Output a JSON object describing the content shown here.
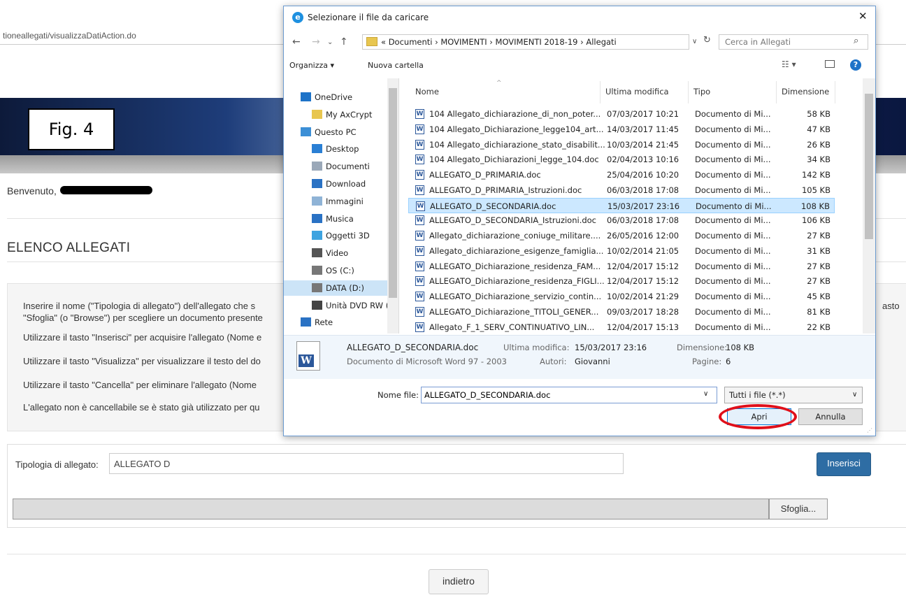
{
  "browser": {
    "url": "tioneallegati/visualizzaDatiAction.do"
  },
  "page": {
    "figure_label": "Fig. 4",
    "welcome": "Benvenuto,",
    "title": "ELENCO ALLEGATI",
    "instructions": [
      "Inserire il nome (\"Tipologia di allegato\") dell'allegato che s",
      "\"Sfoglia\" (o \"Browse\") per scegliere un documento presente",
      "Utilizzare il tasto \"Inserisci\" per acquisire l'allegato (Nome e",
      "Utilizzare il tasto \"Visualizza\" per visualizzare il testo del do",
      "Utilizzare il tasto \"Cancella\" per eliminare l'allegato (Nome",
      "L'allegato non è cancellabile se è stato già utilizzato per qu"
    ],
    "instructions_right": "asto",
    "type_label": "Tipologia di allegato:",
    "type_value": "ALLEGATO D",
    "insert_button": "Inserisci",
    "browse_button": "Sfoglia...",
    "back_button": "indietro"
  },
  "dialog": {
    "title": "Selezionare il file da caricare",
    "close": "✕",
    "breadcrumb": "«  Documenti  ›  MOVIMENTI  ›  MOVIMENTI 2018-19  ›  Allegati",
    "search_placeholder": "Cerca in Allegati",
    "toolbar": {
      "organize": "Organizza ▾",
      "new_folder": "Nuova cartella"
    },
    "nav_items": [
      {
        "label": "OneDrive",
        "icon": "cloud-icon",
        "color": "#1e73c8"
      },
      {
        "label": "My AxCrypt",
        "icon": "folder-icon",
        "color": "#e8c64f"
      },
      {
        "label": "Questo PC",
        "icon": "computer-icon",
        "color": "#3c8fd6"
      },
      {
        "label": "Desktop",
        "icon": "desktop-icon",
        "color": "#2a7fd4"
      },
      {
        "label": "Documenti",
        "icon": "documents-icon",
        "color": "#9aa8b8"
      },
      {
        "label": "Download",
        "icon": "download-icon",
        "color": "#2a72c4"
      },
      {
        "label": "Immagini",
        "icon": "pictures-icon",
        "color": "#8fb3d6"
      },
      {
        "label": "Musica",
        "icon": "music-icon",
        "color": "#2a72c4"
      },
      {
        "label": "Oggetti 3D",
        "icon": "objects-3d-icon",
        "color": "#3da3e0"
      },
      {
        "label": "Video",
        "icon": "video-icon",
        "color": "#555555"
      },
      {
        "label": "OS (C:)",
        "icon": "drive-icon",
        "color": "#777777"
      },
      {
        "label": "DATA (D:)",
        "icon": "drive-icon",
        "color": "#777777"
      },
      {
        "label": "Unità DVD RW (E",
        "icon": "dvd-icon",
        "color": "#444444"
      },
      {
        "label": "Rete",
        "icon": "network-icon",
        "color": "#2a72c4"
      }
    ],
    "columns": [
      "Nome",
      "Ultima modifica",
      "Tipo",
      "Dimensione"
    ],
    "files": [
      {
        "name": "104 Allegato_dichiarazione_di_non_poter...",
        "date": "07/03/2017 10:21",
        "type": "Documento di Mi...",
        "size": "58 KB"
      },
      {
        "name": "104 Allegato_Dichiarazione_legge104_art...",
        "date": "14/03/2017 11:45",
        "type": "Documento di Mi...",
        "size": "47 KB"
      },
      {
        "name": "104 Allegato_dichiarazione_stato_disabilit...",
        "date": "10/03/2014 21:45",
        "type": "Documento di Mi...",
        "size": "26 KB"
      },
      {
        "name": "104 Allegato_Dichiarazioni_legge_104.doc",
        "date": "02/04/2013 10:16",
        "type": "Documento di Mi...",
        "size": "34 KB"
      },
      {
        "name": "ALLEGATO_D_PRIMARIA.doc",
        "date": "25/04/2016 10:20",
        "type": "Documento di Mi...",
        "size": "142 KB"
      },
      {
        "name": "ALLEGATO_D_PRIMARIA_Istruzioni.doc",
        "date": "06/03/2018 17:08",
        "type": "Documento di Mi...",
        "size": "105 KB"
      },
      {
        "name": "ALLEGATO_D_SECONDARIA.doc",
        "date": "15/03/2017 23:16",
        "type": "Documento di Mi...",
        "size": "108 KB"
      },
      {
        "name": "ALLEGATO_D_SECONDARIA_Istruzioni.doc",
        "date": "06/03/2018 17:08",
        "type": "Documento di Mi...",
        "size": "106 KB"
      },
      {
        "name": "Allegato_dichiarazione_coniuge_militare....",
        "date": "26/05/2016 12:00",
        "type": "Documento di Mi...",
        "size": "27 KB"
      },
      {
        "name": "Allegato_dichiarazione_esigenze_famiglia...",
        "date": "10/02/2014 21:05",
        "type": "Documento di Mi...",
        "size": "31 KB"
      },
      {
        "name": "ALLEGATO_Dichiarazione_residenza_FAM...",
        "date": "12/04/2017 15:12",
        "type": "Documento di Mi...",
        "size": "27 KB"
      },
      {
        "name": "ALLEGATO_Dichiarazione_residenza_FIGLI...",
        "date": "12/04/2017 15:12",
        "type": "Documento di Mi...",
        "size": "27 KB"
      },
      {
        "name": "ALLEGATO_Dichiarazione_servizio_contin...",
        "date": "10/02/2014 21:29",
        "type": "Documento di Mi...",
        "size": "45 KB"
      },
      {
        "name": "ALLEGATO_Dichiarazione_TITOLI_GENER...",
        "date": "09/03/2017 18:28",
        "type": "Documento di Mi...",
        "size": "81 KB"
      },
      {
        "name": "Allegato_F_1_SERV_CONTINUATIVO_LIN...",
        "date": "12/04/2017 15:13",
        "type": "Documento di Mi...",
        "size": "22 KB"
      }
    ],
    "selected_index": 6,
    "details": {
      "filename": "ALLEGATO_D_SECONDARIA.doc",
      "filetype": "Documento di Microsoft Word 97 - 2003",
      "modified_label": "Ultima modifica:",
      "modified": "15/03/2017 23:16",
      "authors_label": "Autori:",
      "authors": "Giovanni",
      "size_label": "Dimensione:",
      "size": "108 KB",
      "pages_label": "Pagine:",
      "pages": "6"
    },
    "filename_label": "Nome file:",
    "filename_value": "ALLEGATO_D_SECONDARIA.doc",
    "filter": "Tutti i file (*.*)",
    "open_button": "Apri",
    "cancel_button": "Annulla"
  }
}
